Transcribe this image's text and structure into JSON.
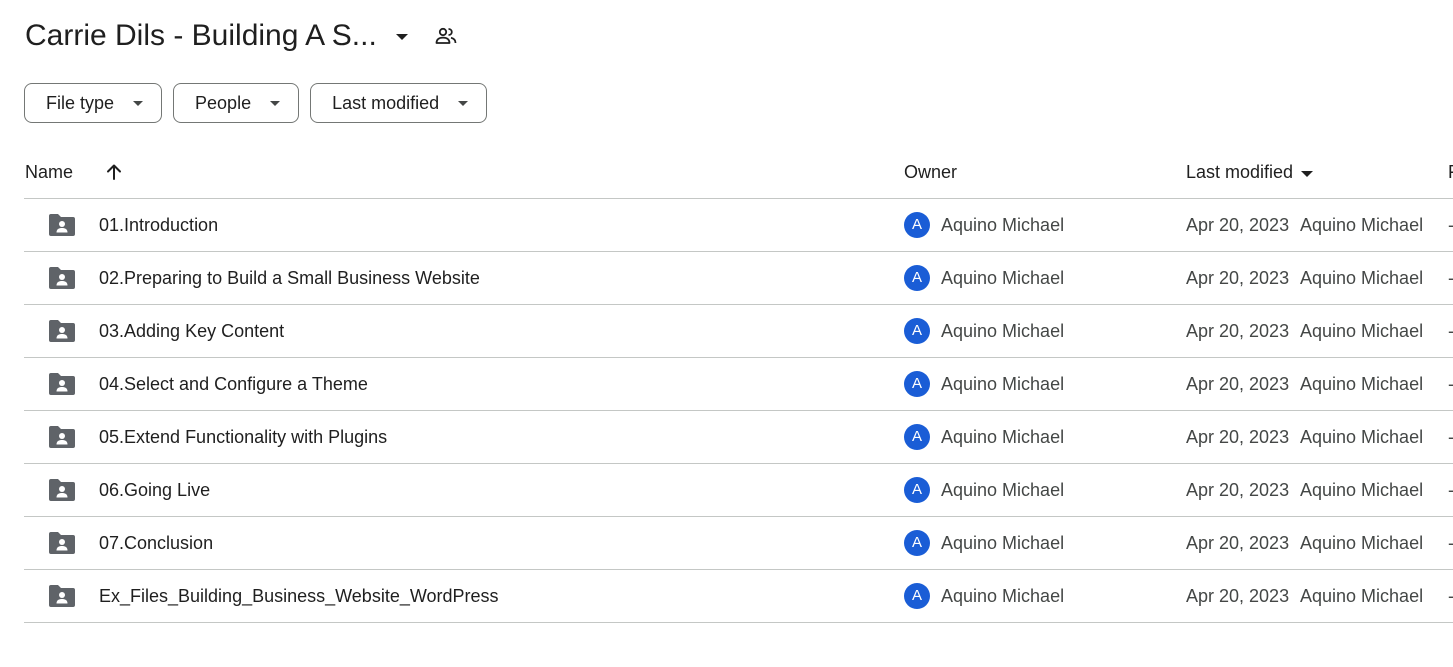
{
  "header": {
    "title": "Carrie Dils - Building A S...",
    "shared_icon": "people-icon"
  },
  "filters": [
    {
      "label": "File type"
    },
    {
      "label": "People"
    },
    {
      "label": "Last modified"
    }
  ],
  "table": {
    "columns": {
      "name": "Name",
      "owner": "Owner",
      "last_modified": "Last modified",
      "file_size": "F"
    },
    "sort_icon": "arrow-up-icon",
    "rows": [
      {
        "name": "01.Introduction",
        "avatar": "A",
        "owner": "Aquino Michael",
        "date": "Apr 20, 2023",
        "modified_by": "Aquino Michael",
        "size": "-"
      },
      {
        "name": "02.Preparing to Build a Small Business Website",
        "avatar": "A",
        "owner": "Aquino Michael",
        "date": "Apr 20, 2023",
        "modified_by": "Aquino Michael",
        "size": "-"
      },
      {
        "name": "03.Adding Key Content",
        "avatar": "A",
        "owner": "Aquino Michael",
        "date": "Apr 20, 2023",
        "modified_by": "Aquino Michael",
        "size": "-"
      },
      {
        "name": "04.Select and Configure a Theme",
        "avatar": "A",
        "owner": "Aquino Michael",
        "date": "Apr 20, 2023",
        "modified_by": "Aquino Michael",
        "size": "-"
      },
      {
        "name": "05.Extend Functionality with Plugins",
        "avatar": "A",
        "owner": "Aquino Michael",
        "date": "Apr 20, 2023",
        "modified_by": "Aquino Michael",
        "size": "-"
      },
      {
        "name": "06.Going Live",
        "avatar": "A",
        "owner": "Aquino Michael",
        "date": "Apr 20, 2023",
        "modified_by": "Aquino Michael",
        "size": "-"
      },
      {
        "name": "07.Conclusion",
        "avatar": "A",
        "owner": "Aquino Michael",
        "date": "Apr 20, 2023",
        "modified_by": "Aquino Michael",
        "size": "-"
      },
      {
        "name": "Ex_Files_Building_Business_Website_WordPress",
        "avatar": "A",
        "owner": "Aquino Michael",
        "date": "Apr 20, 2023",
        "modified_by": "Aquino Michael",
        "size": "-"
      }
    ]
  },
  "colors": {
    "avatar": "#1a5dd6",
    "folder_icon": "#5f6368",
    "divider": "#c4c7c5"
  }
}
